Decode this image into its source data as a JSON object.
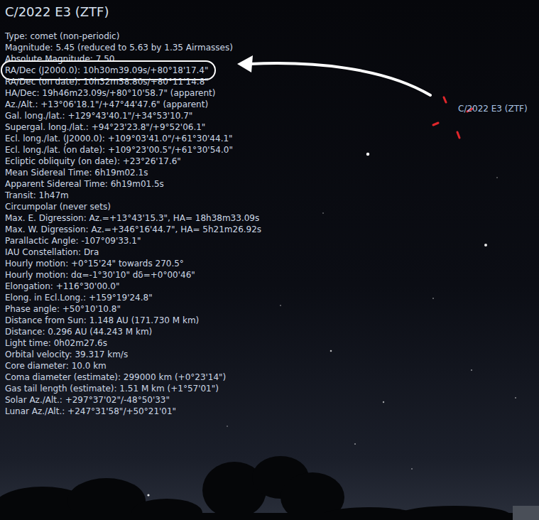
{
  "title": "C/2022 E3 (ZTF)",
  "info_lines": [
    {
      "text": "Type: comet (non-periodic)",
      "highlighted": false
    },
    {
      "text": "Magnitude: 5.45 (reduced to 5.63 by 1.35 Airmasses)",
      "highlighted": false
    },
    {
      "text": "Absolute Magnitude: 7.50",
      "highlighted": false
    },
    {
      "text": "RA/Dec (J2000.0): 10h30m39.09s/+80°18'17.4\"",
      "highlighted": true
    },
    {
      "text": "RA/Dec (on date): 10h32m58.80s/+80°11'14.8\"",
      "highlighted": false
    },
    {
      "text": "HA/Dec: 19h46m23.09s/+80°10'58.7\" (apparent)",
      "highlighted": false
    },
    {
      "text": "Az./Alt.: +13°06'18.1\"/+47°44'47.6\" (apparent)",
      "highlighted": false
    },
    {
      "text": "Gal. long./lat.: +129°43'40.1\"/+34°53'10.7\"",
      "highlighted": false
    },
    {
      "text": "Supergal. long./lat.: +94°23'23.8\"/+9°52'06.1\"",
      "highlighted": false
    },
    {
      "text": "Ecl. long./lat. (J2000.0): +109°03'41.0\"/+61°30'44.1\"",
      "highlighted": false
    },
    {
      "text": "Ecl. long./lat. (on date): +109°23'00.5\"/+61°30'54.0\"",
      "highlighted": false
    },
    {
      "text": "Ecliptic obliquity (on date): +23°26'17.6\"",
      "highlighted": false
    },
    {
      "text": "Mean Sidereal Time: 6h19m02.1s",
      "highlighted": false
    },
    {
      "text": "Apparent Sidereal Time: 6h19m01.5s",
      "highlighted": false
    },
    {
      "text": "Transit: 1h47m",
      "highlighted": false
    },
    {
      "text": "Circumpolar (never sets)",
      "highlighted": false
    },
    {
      "text": "Max. E. Digression: Az.=+13°43'15.3\", HA= 18h38m33.09s",
      "highlighted": false
    },
    {
      "text": "Max. W. Digression: Az.=+346°16'44.7\", HA= 5h21m26.92s",
      "highlighted": false
    },
    {
      "text": "Parallactic Angle: -107°09'33.1\"",
      "highlighted": false
    },
    {
      "text": "IAU Constellation: Dra",
      "highlighted": false
    },
    {
      "text": "Hourly motion: +0°15'24\" towards 270.5°",
      "highlighted": false
    },
    {
      "text": "Hourly motion: dα=-1°30'10\" dδ=+0°00'46\"",
      "highlighted": false
    },
    {
      "text": "Elongation: +116°30'00.0\"",
      "highlighted": false
    },
    {
      "text": "Elong. in Ecl.Long.: +159°19'24.8\"",
      "highlighted": false
    },
    {
      "text": "Phase angle: +50°10'10.8\"",
      "highlighted": false
    },
    {
      "text": "Distance from Sun: 1.148 AU (171.730 M km)",
      "highlighted": false
    },
    {
      "text": "Distance: 0.296 AU (44.243 M km)",
      "highlighted": false
    },
    {
      "text": "Light time: 0h02m27.6s",
      "highlighted": false
    },
    {
      "text": "Orbital velocity: 39.317 km/s",
      "highlighted": false
    },
    {
      "text": "Core diameter: 10.0 km",
      "highlighted": false
    },
    {
      "text": "Coma diameter (estimate): 299000 km (+0°23'14\")",
      "highlighted": false
    },
    {
      "text": "Gas tail length (estimate): 1.51 M km (+1°57'01\")",
      "highlighted": false
    },
    {
      "text": "Solar Az./Alt.: +297°37'02\"/-48°50'33\"",
      "highlighted": false
    },
    {
      "text": "Lunar Az./Alt.: +247°31'58\"/+50°21'01\"",
      "highlighted": false
    }
  ],
  "marker": {
    "label": "C/2022 E3 (ZTF)",
    "selected": true,
    "color": "#e0262b"
  },
  "annotation": {
    "arrow": true
  }
}
